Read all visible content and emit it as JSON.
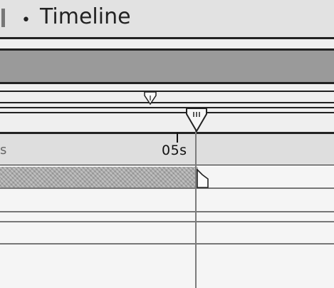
{
  "panel": {
    "bullet": "•",
    "title": "Timeline"
  },
  "ruler": {
    "partial_left_label": "s",
    "tick_label": "05s"
  },
  "icons": {
    "work_area_marker": "small-down-triangle-marker-icon",
    "current_time_indicator": "current-time-indicator-icon",
    "layer_out_point": "layer-out-point-handle-icon"
  },
  "colors": {
    "nav_bar": "#9a9a9a",
    "layer_bar": "#a9a9a9",
    "cti_line": "#7c7c7c"
  }
}
